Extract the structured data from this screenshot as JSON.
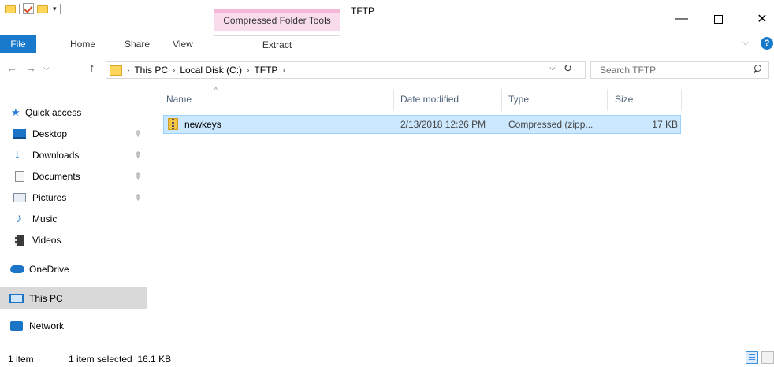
{
  "window": {
    "title": "TFTP",
    "contextual_group": "Compressed Folder Tools",
    "controls": {
      "minimize": "—",
      "maximize": "",
      "close": "✕"
    }
  },
  "ribbon": {
    "tabs": [
      "File",
      "Home",
      "Share",
      "View",
      "Extract"
    ],
    "chevron": "⌵",
    "help": "?"
  },
  "navigation": {
    "back": "←",
    "forward": "→",
    "recent": "⌵",
    "up": "↑",
    "breadcrumbs": [
      "This PC",
      "Local Disk (C:)",
      "TFTP"
    ],
    "crumb_sep": "›",
    "dropdown": "⌵",
    "refresh": "↻",
    "search_placeholder": "Search TFTP"
  },
  "nav_pane": {
    "items": [
      {
        "label": "Quick access",
        "icon": "star-icon"
      },
      {
        "label": "Desktop",
        "icon": "desktop-icon",
        "pinned": true
      },
      {
        "label": "Downloads",
        "icon": "download-icon",
        "pinned": true
      },
      {
        "label": "Documents",
        "icon": "documents-icon",
        "pinned": true
      },
      {
        "label": "Pictures",
        "icon": "pictures-icon",
        "pinned": true
      },
      {
        "label": "Music",
        "icon": "music-icon"
      },
      {
        "label": "Videos",
        "icon": "videos-icon"
      },
      {
        "label": "OneDrive",
        "icon": "onedrive-icon"
      },
      {
        "label": "This PC",
        "icon": "this-pc-icon",
        "selected": true
      },
      {
        "label": "Network",
        "icon": "network-icon"
      }
    ],
    "pin_glyph": "📌"
  },
  "file_list": {
    "columns": [
      "Name",
      "Date modified",
      "Type",
      "Size"
    ],
    "sort_glyph": "^",
    "rows": [
      {
        "name": "newkeys",
        "date_modified": "2/13/2018 12:26 PM",
        "type": "Compressed (zipp...",
        "size": "17 KB",
        "selected": true
      }
    ]
  },
  "status": {
    "item_count": "1 item",
    "selection": "1 item selected  16.1 KB"
  }
}
